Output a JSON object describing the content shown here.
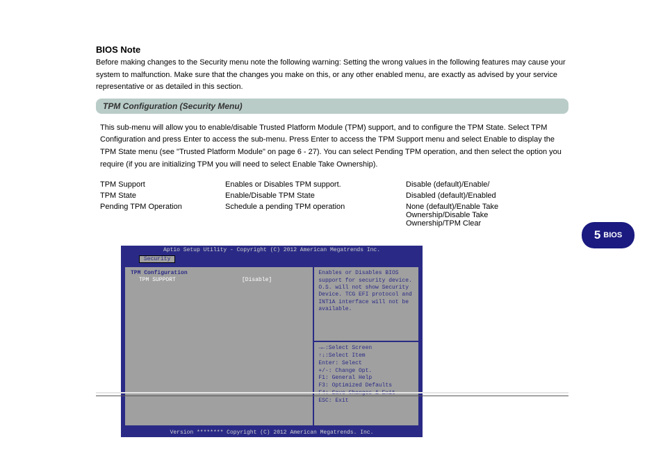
{
  "note": {
    "header": "BIOS Note",
    "body": "Before making changes to the Security menu note the following warning:\nSetting the wrong values in the following features may cause your system to malfunction. Make sure that the changes you make on this, or any other enabled menu, are exactly as advised by your service representative or as detailed in this section."
  },
  "section": {
    "title": "TPM Configuration (Security Menu)",
    "body": "This sub-menu will allow you to enable/disable Trusted Platform Module (TPM) support, and to configure the TPM State. Select TPM Configuration and press Enter to access the sub-menu. Press Enter to access the TPM Support menu and select Enable to display the TPM State menu (see \"Trusted Platform Module\" on page 6 - 27). You can select Pending TPM operation, and then select the option you require (if you are initializing TPM you will need to select Enable Take Ownership)."
  },
  "fields": [
    {
      "name": "TPM Support",
      "desc": "Enables or Disables TPM support.",
      "opts": "Disable (default)/Enable/"
    },
    {
      "name": "TPM State",
      "desc": "Enable/Disable TPM State",
      "opts": "Disabled (default)/Enabled"
    },
    {
      "name": "Pending TPM Operation",
      "desc": "Schedule a pending TPM operation",
      "opts": "None (default)/Enable Take Ownership/Disable Take Ownership/TPM Clear"
    }
  ],
  "bios": {
    "title": "Aptio Setup Utility - Copyright (C) 2012 American Megatrends Inc.",
    "tab": "Security",
    "config_title": "TPM Configuration",
    "option_name": "TPM SUPPORT",
    "option_value": "[Disable]",
    "help": "Enables or Disables BIOS support for security device. O.S. will not show Security Device. TCG EFI protocol and INT1A interface will not be available.",
    "keys": [
      "→←:Select Screen",
      "↑↓:Select Item",
      "Enter: Select",
      "+/-: Change Opt.",
      "F1: General Help",
      "F3: Optimized Defaults",
      "F4: Save Changes & Exit",
      "ESC: Exit"
    ],
    "footer": "Version ******** Copyright (C) 2012 American Megatrends. Inc."
  },
  "badge": {
    "page": "5",
    "label": "BIOS"
  }
}
